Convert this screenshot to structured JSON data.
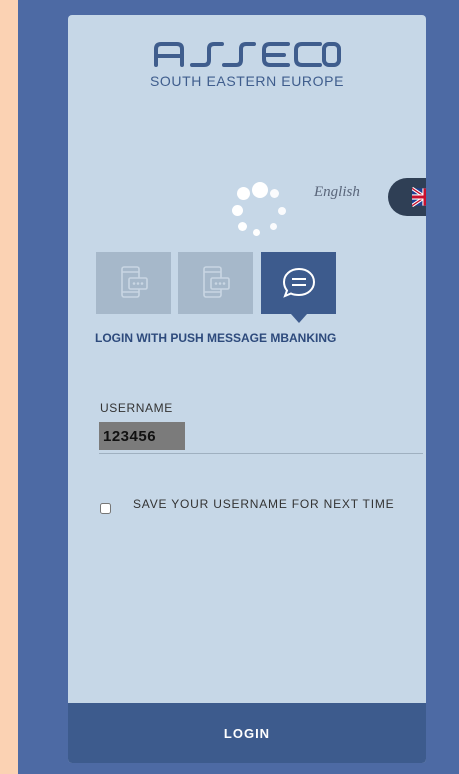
{
  "brand": {
    "logo_text": "asseco",
    "subtitle": "SOUTH EASTERN EUROPE"
  },
  "language": {
    "selected": "English",
    "flag_icon": "uk-flag-icon",
    "toggle_icon": "chevron-left-icon",
    "toggle_glyph": "‹"
  },
  "tabs": [
    {
      "icon": "phone-message-icon",
      "active": false
    },
    {
      "icon": "phone-message-icon",
      "active": false
    },
    {
      "icon": "chat-bubble-icon",
      "active": true
    }
  ],
  "login_mode_label": "LOGIN WITH PUSH MESSAGE MBANKING",
  "username": {
    "label": "USERNAME",
    "value": "123456"
  },
  "save_username": {
    "label": "SAVE YOUR USERNAME FOR NEXT TIME",
    "checked": false
  },
  "login_button": "LOGIN",
  "colors": {
    "outer_background": "#fbd2b3",
    "frame": "#4d6aa4",
    "panel": "#c6d7e7",
    "accent": "#3d5b8d"
  }
}
